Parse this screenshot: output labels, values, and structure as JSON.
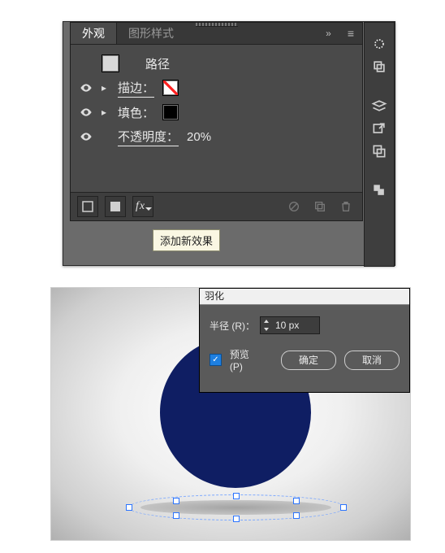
{
  "appearance_panel": {
    "tabs": {
      "appearance": "外观",
      "graphic_styles": "图形样式"
    },
    "menu_glyph": "≡",
    "more_glyph": "»",
    "item_name": "路径",
    "rows": [
      {
        "label": "描边："
      },
      {
        "label": "填色："
      },
      {
        "label": "不透明度：",
        "value": "20%"
      }
    ],
    "fx_tooltip": "添加新效果"
  },
  "right_strip": {
    "icons": [
      "appearance-icon",
      "artboards-icon",
      "layers-icon",
      "export-icon",
      "pathfinder-icon",
      "align-icon"
    ]
  },
  "feather_dialog": {
    "title": "羽化",
    "radius_label": "半径 (R)：",
    "radius_value": "10 px",
    "preview_label": "预览 (P)",
    "ok": "确定",
    "cancel": "取消"
  },
  "colors": {
    "ball": "#0f1e63"
  }
}
